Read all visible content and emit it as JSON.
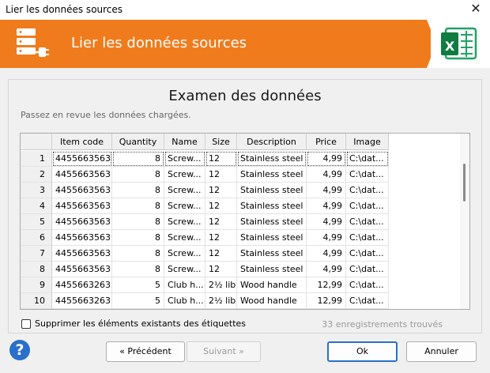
{
  "window": {
    "title": "Lier les données sources",
    "close_glyph": "✕"
  },
  "header": {
    "title": "Lier les données sources",
    "icon": "database-plug-icon",
    "brand_icon": "excel-icon",
    "brand_letter": "X",
    "accent": "#f07b1c"
  },
  "panel": {
    "title": "Examen des données",
    "subtitle": "Passez en revue les données chargées."
  },
  "table": {
    "columns": [
      "Item code",
      "Quantity",
      "Name",
      "Size",
      "Description",
      "Price",
      "Image"
    ],
    "rows": [
      [
        "1",
        "4455663563",
        "8",
        "Screw...",
        "12",
        "Stainless steel",
        "4,99",
        "C:\\dat..."
      ],
      [
        "2",
        "4455663563",
        "8",
        "Screw...",
        "12",
        "Stainless steel",
        "4,99",
        "C:\\dat..."
      ],
      [
        "3",
        "4455663563",
        "8",
        "Screw...",
        "12",
        "Stainless steel",
        "4,99",
        "C:\\dat..."
      ],
      [
        "4",
        "4455663563",
        "8",
        "Screw...",
        "12",
        "Stainless steel",
        "4,99",
        "C:\\dat..."
      ],
      [
        "5",
        "4455663563",
        "8",
        "Screw...",
        "12",
        "Stainless steel",
        "4,99",
        "C:\\dat..."
      ],
      [
        "6",
        "4455663563",
        "8",
        "Screw...",
        "12",
        "Stainless steel",
        "4,99",
        "C:\\dat..."
      ],
      [
        "7",
        "4455663563",
        "8",
        "Screw...",
        "12",
        "Stainless steel",
        "4,99",
        "C:\\dat..."
      ],
      [
        "8",
        "4455663563",
        "8",
        "Screw...",
        "12",
        "Stainless steel",
        "4,99",
        "C:\\dat..."
      ],
      [
        "9",
        "4455663263",
        "5",
        "Club h...",
        "2½ lib",
        "Wood handle",
        "12,99",
        "C:\\dat..."
      ],
      [
        "10",
        "4455663263",
        "5",
        "Club h...",
        "2½ lib",
        "Wood handle",
        "12,99",
        "C:\\dat..."
      ]
    ]
  },
  "options": {
    "remove_existing_label": "Supprimer les éléments existants des étiquettes",
    "remove_existing_checked": false
  },
  "status": {
    "records_found": "33 enregistrements trouvés"
  },
  "buttons": {
    "help_glyph": "?",
    "previous": "« Précédent",
    "next": "Suivant »",
    "ok": "Ok",
    "cancel": "Annuler"
  }
}
